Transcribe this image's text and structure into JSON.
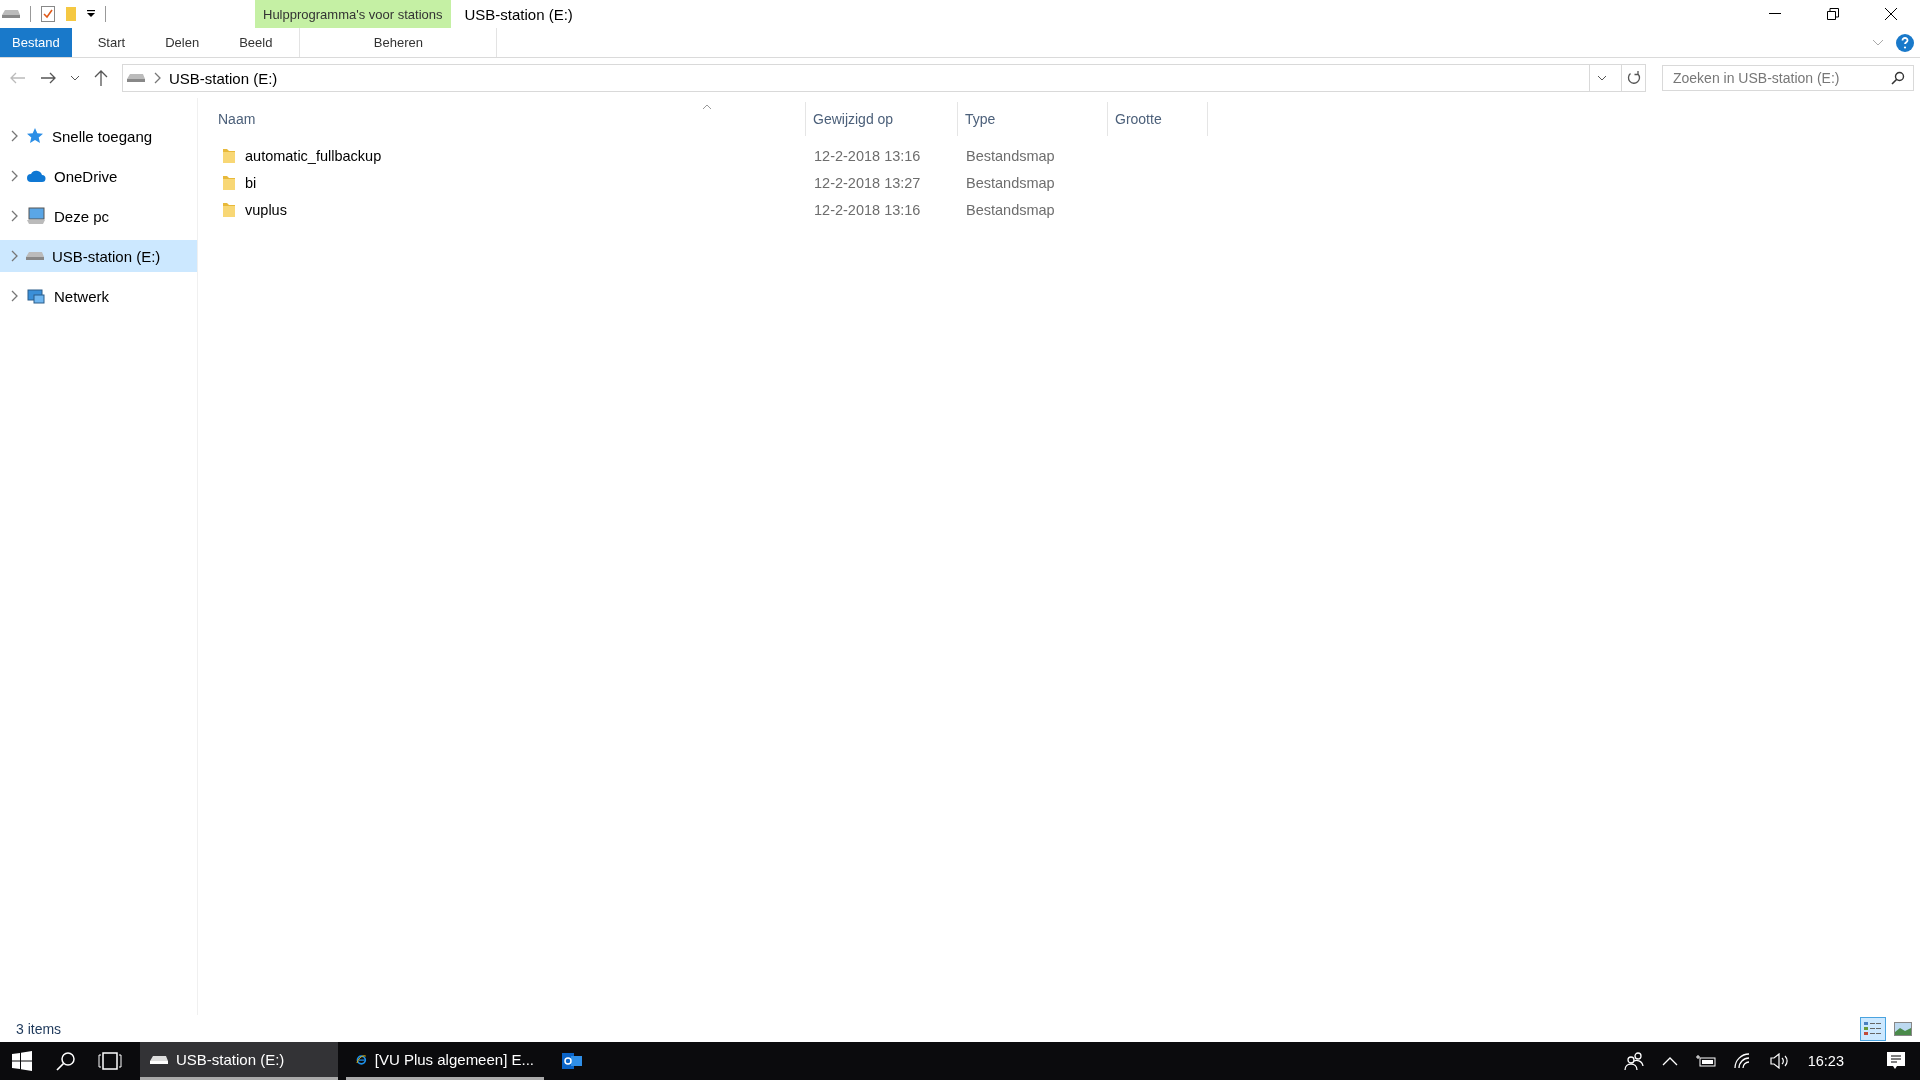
{
  "window": {
    "title": "USB-station (E:)"
  },
  "context_group": {
    "label": "Hulpprogramma's voor stations"
  },
  "ribbon_tabs": [
    {
      "label": "Bestand",
      "kind": "file"
    },
    {
      "label": "Start",
      "kind": "plain"
    },
    {
      "label": "Delen",
      "kind": "plain"
    },
    {
      "label": "Beeld",
      "kind": "plain"
    },
    {
      "label": "Beheren",
      "kind": "context"
    }
  ],
  "address_bar": {
    "path": "USB-station (E:)"
  },
  "search": {
    "placeholder": "Zoeken in USB-station (E:)"
  },
  "sidebar": {
    "items": [
      {
        "label": "Snelle toegang",
        "kind": "star",
        "selected": false
      },
      {
        "label": "OneDrive",
        "kind": "cloud",
        "selected": false
      },
      {
        "label": "Deze pc",
        "kind": "pc",
        "selected": false
      },
      {
        "label": "USB-station (E:)",
        "kind": "drive",
        "selected": true
      },
      {
        "label": "Netwerk",
        "kind": "network",
        "selected": false
      }
    ]
  },
  "table": {
    "columns": [
      "Naam",
      "Gewijzigd op",
      "Type",
      "Grootte"
    ],
    "rows": [
      {
        "name": "automatic_fullbackup",
        "modified": "12-2-2018 13:16",
        "type": "Bestandsmap"
      },
      {
        "name": "bi",
        "modified": "12-2-2018 13:27",
        "type": "Bestandsmap"
      },
      {
        "name": "vuplus",
        "modified": "12-2-2018 13:16",
        "type": "Bestandsmap"
      }
    ]
  },
  "status_bar": {
    "text": "3 items"
  },
  "view_buttons": [
    {
      "kind": "details",
      "selected": true
    },
    {
      "kind": "large_icons",
      "selected": false
    }
  ],
  "taskbar": {
    "apps": [
      {
        "label": "USB-station (E:)",
        "kind": "drive",
        "selected": true
      },
      {
        "label": "[VU Plus algemeen] E...",
        "kind": "browser",
        "selected": false
      },
      {
        "kind": "mail",
        "selected": false
      }
    ],
    "clock": "16:23"
  }
}
